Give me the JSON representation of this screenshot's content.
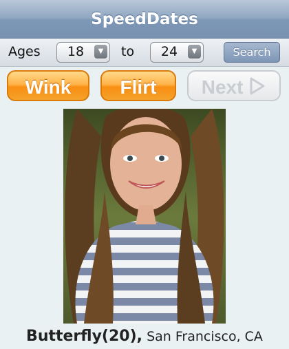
{
  "app": {
    "title": "SpeedDates"
  },
  "filter": {
    "ages_label": "Ages",
    "min_age": "18",
    "to_label": "to",
    "max_age": "24",
    "search_label": "Search"
  },
  "actions": {
    "wink_label": "Wink",
    "flirt_label": "Flirt",
    "next_label": "Next"
  },
  "profile": {
    "name_age": "Butterfly(20),",
    "location": "San Francisco, CA"
  },
  "colors": {
    "title_bar": "#8fa6c1",
    "orange_button": "#f98f12",
    "background": "#e9f1f3"
  },
  "icons": {
    "select_arrow": "chevron-down-icon",
    "next_arrow": "play-icon"
  }
}
